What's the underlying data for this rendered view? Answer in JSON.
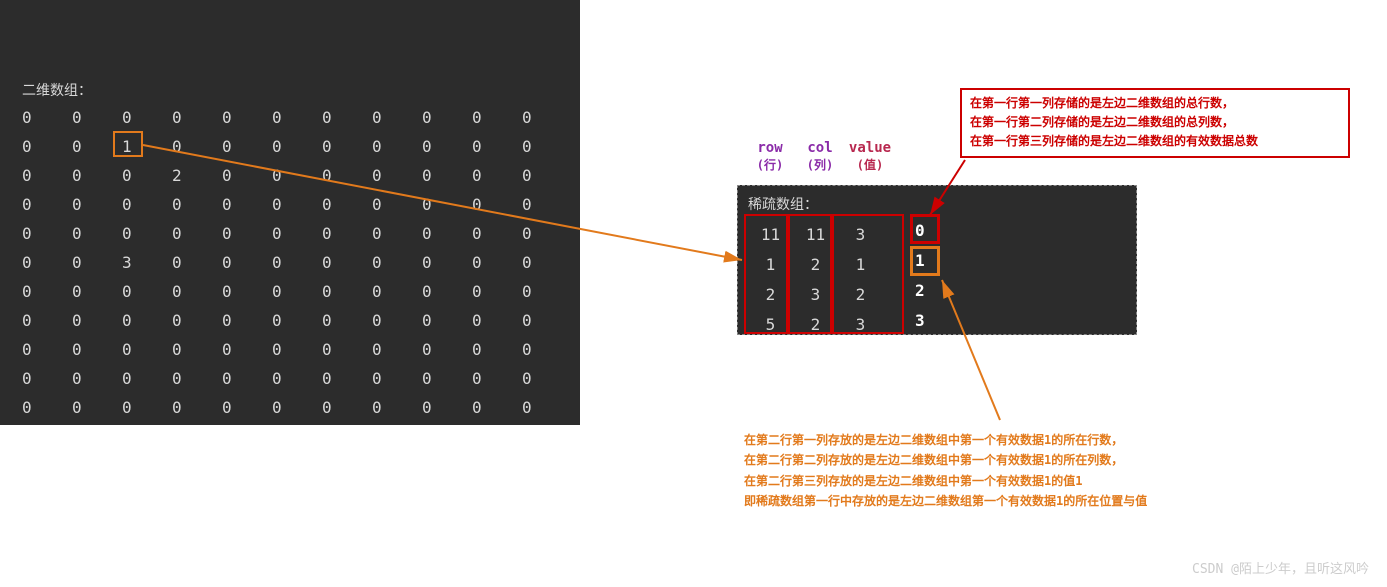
{
  "left": {
    "title": "二维数组：",
    "matrix": [
      [
        0,
        0,
        0,
        0,
        0,
        0,
        0,
        0,
        0,
        0,
        0
      ],
      [
        0,
        0,
        1,
        0,
        0,
        0,
        0,
        0,
        0,
        0,
        0
      ],
      [
        0,
        0,
        0,
        2,
        0,
        0,
        0,
        0,
        0,
        0,
        0
      ],
      [
        0,
        0,
        0,
        0,
        0,
        0,
        0,
        0,
        0,
        0,
        0
      ],
      [
        0,
        0,
        0,
        0,
        0,
        0,
        0,
        0,
        0,
        0,
        0
      ],
      [
        0,
        0,
        3,
        0,
        0,
        0,
        0,
        0,
        0,
        0,
        0
      ],
      [
        0,
        0,
        0,
        0,
        0,
        0,
        0,
        0,
        0,
        0,
        0
      ],
      [
        0,
        0,
        0,
        0,
        0,
        0,
        0,
        0,
        0,
        0,
        0
      ],
      [
        0,
        0,
        0,
        0,
        0,
        0,
        0,
        0,
        0,
        0,
        0
      ],
      [
        0,
        0,
        0,
        0,
        0,
        0,
        0,
        0,
        0,
        0,
        0
      ],
      [
        0,
        0,
        0,
        0,
        0,
        0,
        0,
        0,
        0,
        0,
        0
      ]
    ]
  },
  "headers": {
    "row": "row",
    "row_sub": "(行)",
    "col": "col",
    "col_sub": "(列)",
    "val": "value",
    "val_sub": "(值)"
  },
  "right": {
    "title": "稀疏数组：",
    "rows": [
      {
        "r": "11",
        "c": "11",
        "v": "3",
        "idx": "0"
      },
      {
        "r": "1",
        "c": "2",
        "v": "1",
        "idx": "1"
      },
      {
        "r": "2",
        "c": "3",
        "v": "2",
        "idx": "2"
      },
      {
        "r": "5",
        "c": "2",
        "v": "3",
        "idx": "3"
      }
    ]
  },
  "note1": {
    "l1": "在第一行第一列存储的是左边二维数组的总行数，",
    "l2": "在第一行第二列存储的是左边二维数组的总列数，",
    "l3": "在第一行第三列存储的是左边二维数组的有效数据总数"
  },
  "note2": {
    "l1": "在第二行第一列存放的是左边二维数组中第一个有效数据1的所在行数，",
    "l2": "在第二行第二列存放的是左边二维数组中第一个有效数据1的所在列数，",
    "l3": "在第二行第三列存放的是左边二维数组中第一个有效数据1的值1",
    "l4": "即稀疏数组第一行中存放的是左边二维数组第一个有效数据1的所在位置与值"
  },
  "watermark": "CSDN @陌上少年，且听这风吟"
}
